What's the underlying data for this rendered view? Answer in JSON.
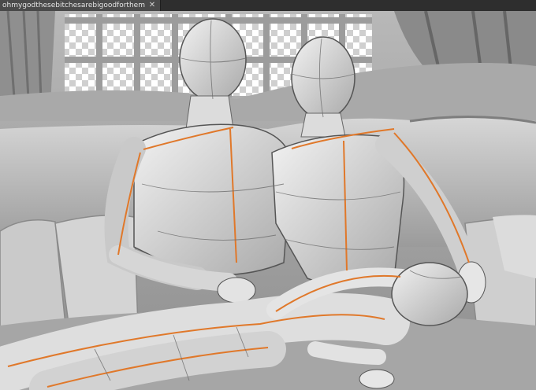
{
  "document_tab": {
    "title": "ohmygodthesebitchesarebigoodforthem",
    "close_glyph": "✕"
  },
  "viewport": {
    "background_color": "#9a9a9a",
    "guide_line_color": "#e0782a",
    "content": "3d-pose-mannequins"
  },
  "icons": {
    "close": "close-icon"
  }
}
